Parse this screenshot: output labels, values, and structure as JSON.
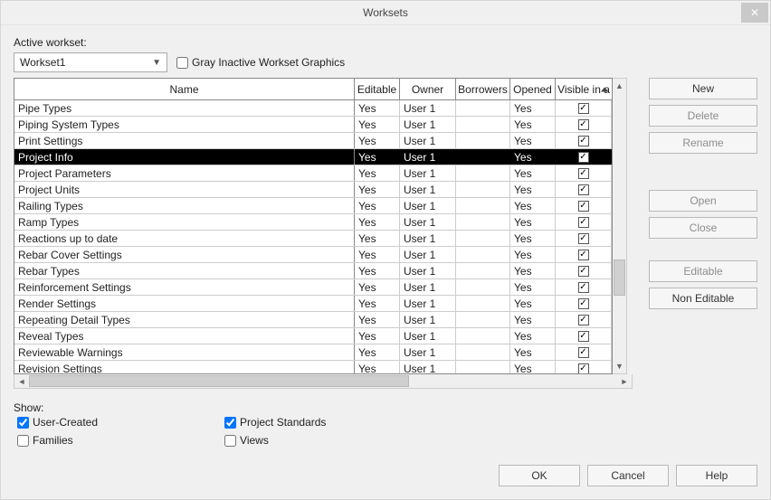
{
  "title": "Worksets",
  "active_label": "Active workset:",
  "active_value": "Workset1",
  "gray_label": "Gray Inactive Workset Graphics",
  "gray_checked": false,
  "columns": {
    "name": "Name",
    "editable": "Editable",
    "owner": "Owner",
    "borrowers": "Borrowers",
    "opened": "Opened",
    "visible": "Visible in a"
  },
  "rows": [
    {
      "name": "Pipe Types",
      "editable": "Yes",
      "owner": "User 1",
      "borrowers": "",
      "opened": "Yes",
      "visible": true,
      "selected": false
    },
    {
      "name": "Piping System Types",
      "editable": "Yes",
      "owner": "User 1",
      "borrowers": "",
      "opened": "Yes",
      "visible": true,
      "selected": false
    },
    {
      "name": "Print Settings",
      "editable": "Yes",
      "owner": "User 1",
      "borrowers": "",
      "opened": "Yes",
      "visible": true,
      "selected": false
    },
    {
      "name": "Project Info",
      "editable": "Yes",
      "owner": "User 1",
      "borrowers": "",
      "opened": "Yes",
      "visible": true,
      "selected": true
    },
    {
      "name": "Project Parameters",
      "editable": "Yes",
      "owner": "User 1",
      "borrowers": "",
      "opened": "Yes",
      "visible": true,
      "selected": false
    },
    {
      "name": "Project Units",
      "editable": "Yes",
      "owner": "User 1",
      "borrowers": "",
      "opened": "Yes",
      "visible": true,
      "selected": false
    },
    {
      "name": "Railing Types",
      "editable": "Yes",
      "owner": "User 1",
      "borrowers": "",
      "opened": "Yes",
      "visible": true,
      "selected": false
    },
    {
      "name": "Ramp Types",
      "editable": "Yes",
      "owner": "User 1",
      "borrowers": "",
      "opened": "Yes",
      "visible": true,
      "selected": false
    },
    {
      "name": "Reactions up to date",
      "editable": "Yes",
      "owner": "User 1",
      "borrowers": "",
      "opened": "Yes",
      "visible": true,
      "selected": false
    },
    {
      "name": "Rebar Cover Settings",
      "editable": "Yes",
      "owner": "User 1",
      "borrowers": "",
      "opened": "Yes",
      "visible": true,
      "selected": false
    },
    {
      "name": "Rebar Types",
      "editable": "Yes",
      "owner": "User 1",
      "borrowers": "",
      "opened": "Yes",
      "visible": true,
      "selected": false
    },
    {
      "name": "Reinforcement Settings",
      "editable": "Yes",
      "owner": "User 1",
      "borrowers": "",
      "opened": "Yes",
      "visible": true,
      "selected": false
    },
    {
      "name": "Render Settings",
      "editable": "Yes",
      "owner": "User 1",
      "borrowers": "",
      "opened": "Yes",
      "visible": true,
      "selected": false
    },
    {
      "name": "Repeating Detail Types",
      "editable": "Yes",
      "owner": "User 1",
      "borrowers": "",
      "opened": "Yes",
      "visible": true,
      "selected": false
    },
    {
      "name": "Reveal Types",
      "editable": "Yes",
      "owner": "User 1",
      "borrowers": "",
      "opened": "Yes",
      "visible": true,
      "selected": false
    },
    {
      "name": "Reviewable Warnings",
      "editable": "Yes",
      "owner": "User 1",
      "borrowers": "",
      "opened": "Yes",
      "visible": true,
      "selected": false
    },
    {
      "name": "Revision Settings",
      "editable": "Yes",
      "owner": "User 1",
      "borrowers": "",
      "opened": "Yes",
      "visible": true,
      "selected": false
    }
  ],
  "side": {
    "new": "New",
    "delete": "Delete",
    "rename": "Rename",
    "open": "Open",
    "close": "Close",
    "editable": "Editable",
    "non_editable": "Non Editable"
  },
  "show": {
    "label": "Show:",
    "user_created": "User-Created",
    "families": "Families",
    "project_standards": "Project Standards",
    "views": "Views"
  },
  "footer": {
    "ok": "OK",
    "cancel": "Cancel",
    "help": "Help"
  }
}
